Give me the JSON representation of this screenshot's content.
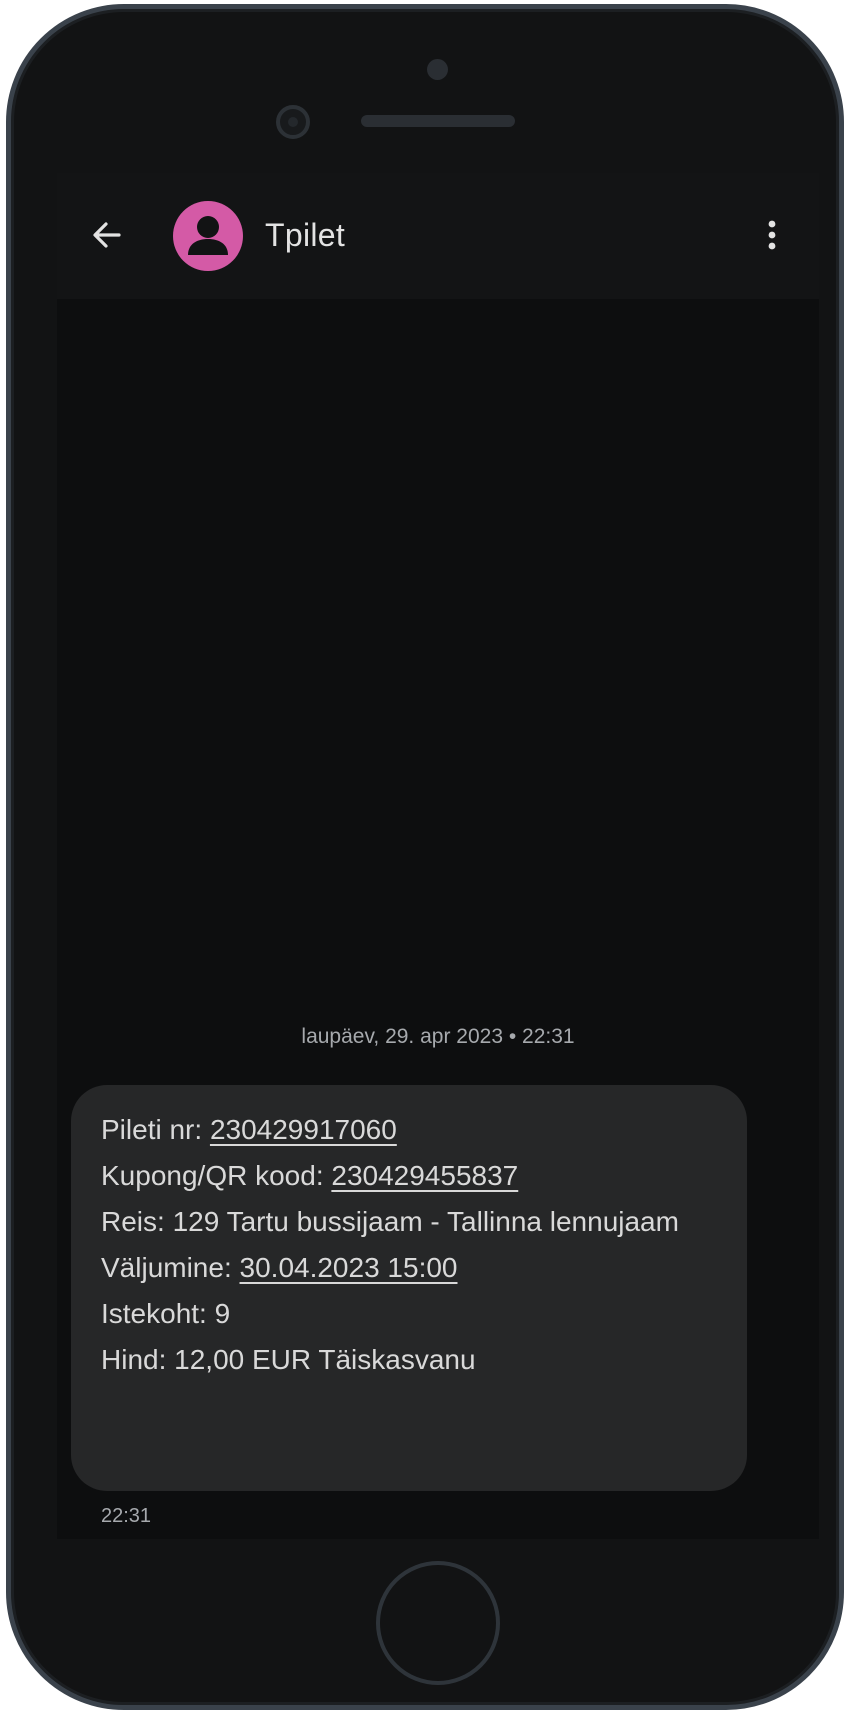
{
  "app_bar": {
    "contact_name": "Tpilet",
    "back_icon": "arrow-back-icon",
    "avatar_icon": "person-avatar-icon",
    "more_icon": "more-vertical-icon",
    "avatar_color": "#d45aa6"
  },
  "conversation": {
    "date_divider": "laupäev, 29. apr 2023 • 22:31",
    "message": {
      "ticket_label": "Pileti nr: ",
      "ticket_number": "230429917060",
      "coupon_label": "Kupong/QR kood: ",
      "coupon_number": "230429455837",
      "trip": "Reis: 129 Tartu bussijaam - Tallinna lennujaam",
      "departure_label": "Väljumine: ",
      "departure_datetime": "30.04.2023 15:00",
      "seat": "Istekoht: 9",
      "price": "Hind: 12,00 EUR Täiskasvanu"
    },
    "message_time": "22:31"
  },
  "colors": {
    "screen_background": "#0d0e0f",
    "bubble_background": "#262728",
    "text": "#d9d9d9",
    "muted_text": "#a6a9ad"
  }
}
